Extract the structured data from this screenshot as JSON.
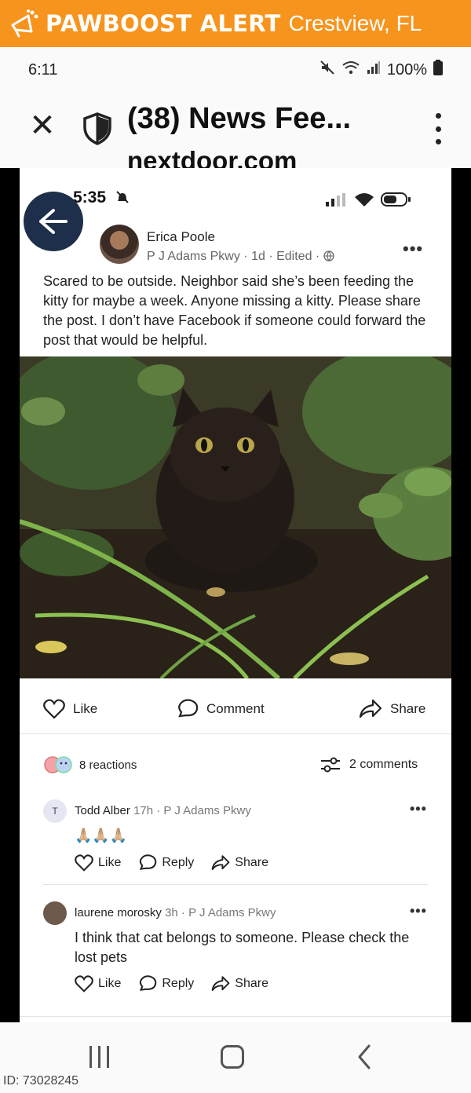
{
  "banner": {
    "brand": "PAWBOOST ALERT",
    "city": "Crestview, FL",
    "color": "#f7941d"
  },
  "statusbar": {
    "time": "6:11",
    "battery": "100%"
  },
  "browser": {
    "title": "(38) News Fee...",
    "url": "nextdoor.com"
  },
  "inner": {
    "time": "5:35"
  },
  "post": {
    "author": "Erica Poole",
    "meta": "P J Adams Pkwy · 1d · Edited ·",
    "text": "Scared to be outside. Neighbor said she’s been feeding the kitty for maybe a week. Anyone missing a kitty. Please share the post. I don’t have Facebook if someone could forward the post that would be helpful.",
    "like": "Like",
    "comment": "Comment",
    "share": "Share",
    "reactions": "8 reactions",
    "comments_count": "2 comments"
  },
  "comments": [
    {
      "initial": "T",
      "name": "Todd Alber",
      "meta": "17h · P J Adams Pkwy",
      "body": "🙏🏼🙏🏼🙏🏼",
      "like": "Like",
      "reply": "Reply",
      "share": "Share"
    },
    {
      "initial": "",
      "name": "laurene morosky",
      "meta": "3h · P J Adams Pkwy",
      "body": "I think that cat belongs to someone. Please check the lost pets",
      "like": "Like",
      "reply": "Reply",
      "share": "Share"
    }
  ],
  "watermark": "ID: 73028245"
}
